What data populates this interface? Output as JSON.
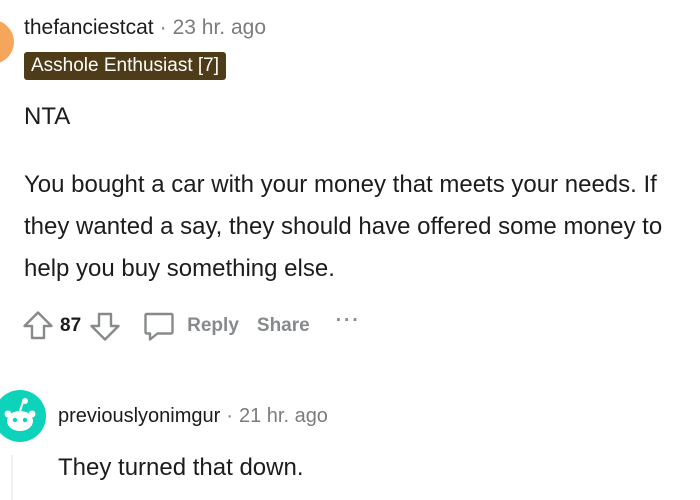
{
  "comment1": {
    "username": "thefanciestcat",
    "separator": "·",
    "time": "23 hr. ago",
    "flair": "Asshole Enthusiast [7]",
    "paragraph1": "NTA",
    "paragraph2": "You bought a car with your money that meets your needs. If they wanted a say, they should have offered some money to help you buy something else.",
    "score": "87",
    "reply_label": "Reply",
    "share_label": "Share",
    "more_label": "···"
  },
  "comment2": {
    "username": "previouslyonimgur",
    "separator": "·",
    "time": "21 hr. ago",
    "text": "They turned that down."
  },
  "colors": {
    "flair_bg": "#4e3b17",
    "avatar2_bg": "#0dd3bb",
    "action_gray": "#878a8c"
  }
}
